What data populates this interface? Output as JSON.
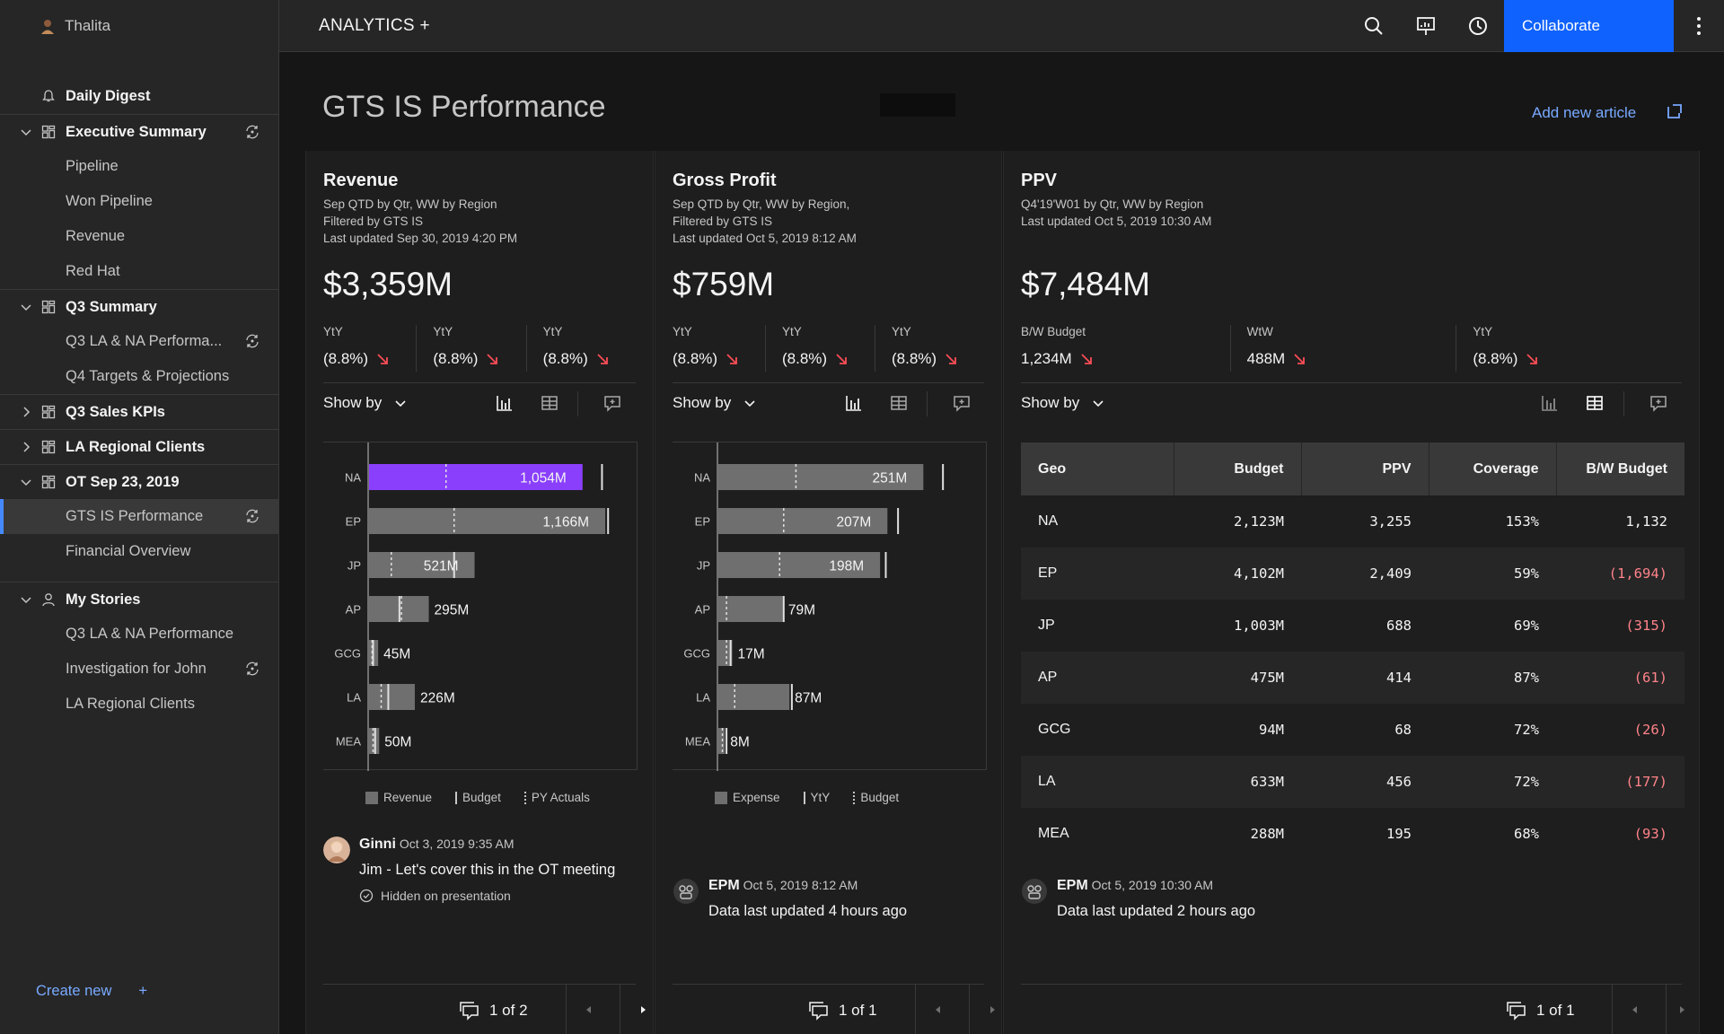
{
  "user": {
    "name": "Thalita"
  },
  "topbar": {
    "title": "ANALYTICS +",
    "collaborate_label": "Collaborate"
  },
  "sidebar": {
    "items": [
      {
        "label": "Daily Digest",
        "kind": "group",
        "icon": "bell-icon"
      },
      {
        "label": "Executive Summary",
        "kind": "group",
        "icon": "dashboard-icon",
        "expanded": true,
        "sync": true
      },
      {
        "label": "Pipeline",
        "kind": "child"
      },
      {
        "label": "Won Pipeline",
        "kind": "child"
      },
      {
        "label": "Revenue",
        "kind": "child"
      },
      {
        "label": "Red Hat",
        "kind": "child"
      },
      {
        "label": "Q3 Summary",
        "kind": "group",
        "icon": "dashboard-icon",
        "expanded": true
      },
      {
        "label": "Q3 LA & NA Performa...",
        "kind": "child",
        "sync": true
      },
      {
        "label": "Q4 Targets & Projections",
        "kind": "child"
      },
      {
        "label": "Q3 Sales KPIs",
        "kind": "group",
        "icon": "dashboard-icon",
        "expanded": false
      },
      {
        "label": "LA Regional Clients",
        "kind": "group",
        "icon": "dashboard-icon",
        "expanded": false
      },
      {
        "label": "OT Sep 23, 2019",
        "kind": "group",
        "icon": "dashboard-icon",
        "expanded": true
      },
      {
        "label": "GTS IS Performance",
        "kind": "child",
        "active": true,
        "sync": true
      },
      {
        "label": "Financial Overview",
        "kind": "child"
      },
      {
        "label": "My Stories",
        "kind": "group",
        "icon": "user-icon",
        "expanded": true
      },
      {
        "label": "Q3 LA & NA Performance",
        "kind": "child"
      },
      {
        "label": "Investigation for John",
        "kind": "child",
        "sync": true
      },
      {
        "label": "LA Regional Clients",
        "kind": "child"
      }
    ],
    "create_new": "Create new",
    "create_plus": "+"
  },
  "page": {
    "title": "GTS IS Performance",
    "add_article": "Add new article"
  },
  "cards": [
    {
      "title": "Revenue",
      "subtitle": [
        "Sep QTD by Qtr, WW by Region",
        "Filtered by GTS IS",
        "Last updated Sep 30, 2019 4:20 PM"
      ],
      "big_value": "$3,359M",
      "kpis": [
        {
          "label": "YtY",
          "value": "(8.8%)"
        },
        {
          "label": "YtY",
          "value": "(8.8%)"
        },
        {
          "label": "YtY",
          "value": "(8.8%)"
        }
      ],
      "show_by": "Show by",
      "legend": [
        "Revenue",
        "Budget",
        "PY Actuals"
      ],
      "comment": {
        "author": "Ginni",
        "time": "Oct 3, 2019 9:35 AM",
        "text": "Jim - Let's cover this in the OT meeting",
        "note": "Hidden on presentation"
      },
      "pagination": "1 of 2"
    },
    {
      "title": "Gross Profit",
      "subtitle": [
        "Sep QTD by Qtr, WW by Region,",
        "Filtered by GTS IS",
        "Last updated Oct 5, 2019 8:12 AM"
      ],
      "big_value": "$759M",
      "kpis": [
        {
          "label": "YtY",
          "value": "(8.8%)"
        },
        {
          "label": "YtY",
          "value": "(8.8%)"
        },
        {
          "label": "YtY",
          "value": "(8.8%)"
        }
      ],
      "show_by": "Show by",
      "legend": [
        "Expense",
        "YtY",
        "Budget"
      ],
      "comment": {
        "author": "EPM",
        "time": "Oct 5, 2019 8:12 AM",
        "text": "Data last updated 4 hours ago"
      },
      "pagination": "1 of 1"
    },
    {
      "title": "PPV",
      "subtitle": [
        "Q4'19'W01 by Qtr, WW by Region",
        "Last updated Oct 5, 2019 10:30 AM"
      ],
      "big_value": "$7,484M",
      "kpis": [
        {
          "label": "B/W Budget",
          "value": "1,234M"
        },
        {
          "label": "WtW",
          "value": "488M"
        },
        {
          "label": "YtY",
          "value": "(8.8%)"
        }
      ],
      "show_by": "Show by",
      "table": {
        "headers": [
          "Geo",
          "Budget",
          "PPV",
          "Coverage",
          "B/W Budget"
        ],
        "rows": [
          [
            "NA",
            "2,123M",
            "3,255",
            "153%",
            "1,132"
          ],
          [
            "EP",
            "4,102M",
            "2,409",
            "59%",
            "(1,694)"
          ],
          [
            "JP",
            "1,003M",
            "688",
            "69%",
            "(315)"
          ],
          [
            "AP",
            "475M",
            "414",
            "87%",
            "(61)"
          ],
          [
            "GCG",
            "94M",
            "68",
            "72%",
            "(26)"
          ],
          [
            "LA",
            "633M",
            "456",
            "72%",
            "(177)"
          ],
          [
            "MEA",
            "288M",
            "195",
            "68%",
            "(93)"
          ]
        ]
      },
      "comment": {
        "author": "EPM",
        "time": "Oct 5, 2019 10:30 AM",
        "text": "Data last updated 2 hours ago"
      },
      "pagination": "1 of 1"
    }
  ],
  "colors": {
    "accent": "#0f62fe",
    "highlight_bar": "#8a3ffc",
    "bar": "#6f6f6f",
    "negative": "#ff8389",
    "arrow": "#fa4d56",
    "link": "#78a9ff"
  },
  "chart_data": [
    {
      "type": "bar",
      "orientation": "horizontal",
      "categories": [
        "NA",
        "EP",
        "JP",
        "AP",
        "GCG",
        "LA",
        "MEA"
      ],
      "series": [
        {
          "name": "Revenue",
          "values": [
            1054,
            1166,
            521,
            295,
            45,
            226,
            50
          ]
        },
        {
          "name": "Budget",
          "values": [
            1150,
            1180,
            420,
            150,
            20,
            95,
            30
          ]
        },
        {
          "name": "PY Actuals",
          "values": [
            380,
            420,
            110,
            160,
            15,
            60,
            20
          ]
        }
      ],
      "data_labels": [
        "1,054M",
        "1,166M",
        "521M",
        "295M",
        "45M",
        "226M",
        "50M"
      ],
      "highlight_index": 0,
      "xlim": [
        0,
        1250
      ]
    },
    {
      "type": "bar",
      "orientation": "horizontal",
      "categories": [
        "NA",
        "EP",
        "JP",
        "AP",
        "GCG",
        "LA",
        "MEA"
      ],
      "series": [
        {
          "name": "Expense",
          "values": [
            251,
            207,
            198,
            79,
            17,
            87,
            8
          ]
        },
        {
          "name": "YtY",
          "values": [
            275,
            220,
            205,
            80,
            15,
            90,
            10
          ]
        },
        {
          "name": "Budget",
          "values": [
            95,
            80,
            75,
            10,
            10,
            20,
            5
          ]
        }
      ],
      "data_labels": [
        "251M",
        "207M",
        "198M",
        "79M",
        "17M",
        "87M",
        "8M"
      ],
      "xlim": [
        0,
        310
      ]
    }
  ]
}
